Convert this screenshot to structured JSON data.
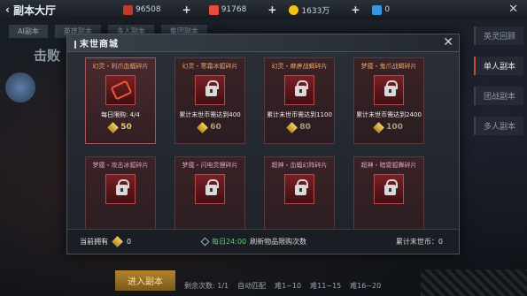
{
  "topbar": {
    "title": "副本大厅",
    "resources": [
      {
        "icon": "red-gem-icon",
        "value": "96508",
        "color": "#c0392b"
      },
      {
        "icon": "ruby-icon",
        "value": "91768",
        "color": "#e74c3c"
      },
      {
        "icon": "gold-coin-icon",
        "value": "1633万",
        "color": "#f1c40f"
      },
      {
        "icon": "blue-trophy-icon",
        "value": "0",
        "color": "#3498db"
      }
    ]
  },
  "lobby": {
    "tabs": [
      "AI副本",
      "英雄副本",
      "多人副本",
      "集团副本"
    ],
    "big_text": "击败",
    "right_menu": [
      {
        "label": "英灵回顾",
        "active": false
      },
      {
        "label": "单人副本",
        "active": true
      },
      {
        "label": "团战副本",
        "active": false
      },
      {
        "label": "多人副本",
        "active": false
      }
    ],
    "bottom": {
      "enter": "进入副本",
      "remain": "剩余次数: 1/1",
      "auto": "自动匹配",
      "stage1": "难1~10",
      "stage2": "难11~15",
      "stage3": "难16~20"
    }
  },
  "modal": {
    "title": "末世商城",
    "close": "✕",
    "items": [
      {
        "name": "幻灵・利爪血蝠碎片",
        "cond": "每日限购:  4/4",
        "price": "50",
        "locked": false,
        "selected": true,
        "name_color": "orange"
      },
      {
        "name": "幻灵・寒霜冰狐碎片",
        "cond": "累计末世币需达到400",
        "price": "60",
        "locked": true,
        "selected": false,
        "name_color": "orange"
      },
      {
        "name": "幻灵・麻痹战蝎碎片",
        "cond": "累计末世币需达到1100",
        "price": "80",
        "locked": true,
        "selected": false,
        "name_color": "orange"
      },
      {
        "name": "梦魇・鬼爪战蝎碎片",
        "cond": "累计末世币需达到2400",
        "price": "100",
        "locked": true,
        "selected": false,
        "name_color": "orange"
      },
      {
        "name": "梦魇・攻击冰狐碎片",
        "cond": "",
        "price": "",
        "locked": true,
        "selected": false,
        "name_color": "pink"
      },
      {
        "name": "梦魇・闪电灵狸碎片",
        "cond": "",
        "price": "",
        "locked": true,
        "selected": false,
        "name_color": "pink"
      },
      {
        "name": "超神・血蝠幻阵碎片",
        "cond": "",
        "price": "",
        "locked": true,
        "selected": false,
        "name_color": "pink"
      },
      {
        "name": "超神・暗雷狐舞碎片",
        "cond": "",
        "price": "",
        "locked": true,
        "selected": false,
        "name_color": "pink"
      }
    ],
    "footer": {
      "own_label": "当前拥有",
      "own_value": "0",
      "refresh_time": "每日24:00",
      "refresh_text": "刷新物品限购次数",
      "currency": "累计末世币：0"
    }
  }
}
